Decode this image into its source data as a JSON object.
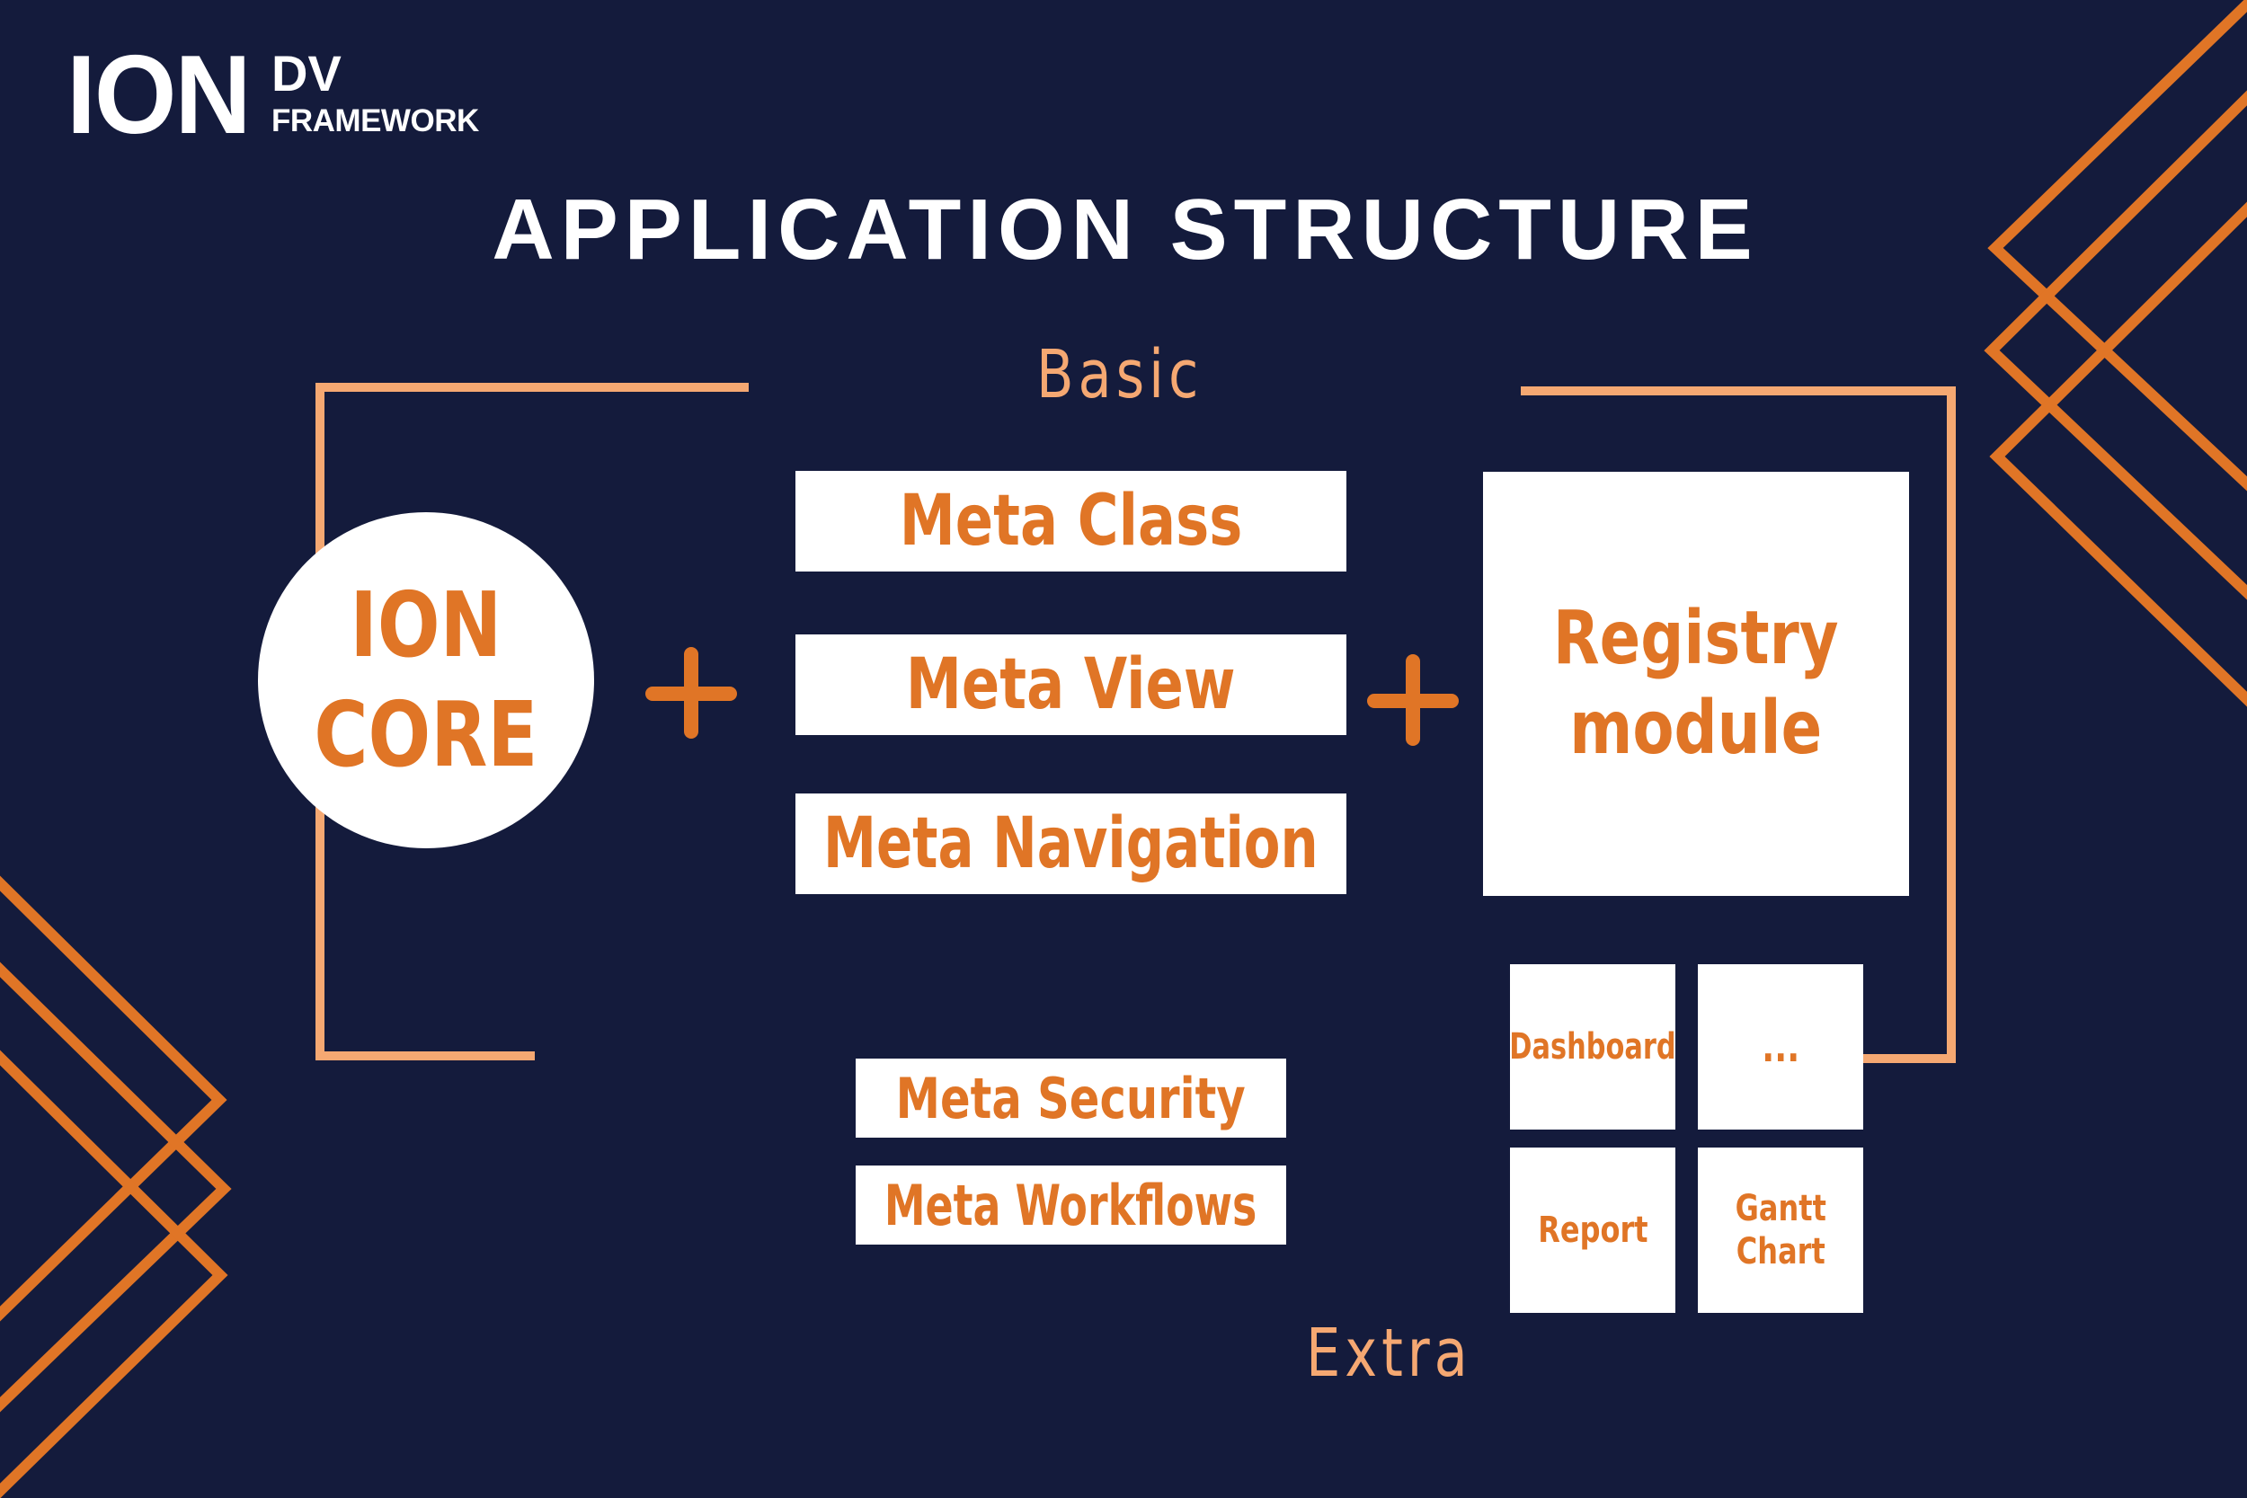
{
  "logo": {
    "main": "ION",
    "superscript": "DV",
    "subscript": "FRAMEWORK"
  },
  "title": "APPLICATION STRUCTURE",
  "sections": {
    "basic_label": "Basic",
    "extra_label": "Extra"
  },
  "core": {
    "line1": "ION",
    "line2": "CORE"
  },
  "operators": {
    "plus_symbol": "plus-icon"
  },
  "basic_meta": [
    {
      "label": "Meta Class"
    },
    {
      "label": "Meta View"
    },
    {
      "label": "Meta Navigation"
    }
  ],
  "registry": {
    "line1": "Registry",
    "line2": "module"
  },
  "extra_meta": [
    {
      "label": "Meta Security"
    },
    {
      "label": "Meta Workflows"
    }
  ],
  "extra_modules": [
    {
      "label": "Dashboard"
    },
    {
      "label": "..."
    },
    {
      "label": "Report"
    },
    {
      "label_line1": "Gantt",
      "label_line2": "Chart"
    }
  ],
  "colors": {
    "background": "#141b3c",
    "accent_orange": "#e07526",
    "bracket_peach": "#f5a872",
    "box_white": "#ffffff",
    "title_white": "#ffffff"
  }
}
